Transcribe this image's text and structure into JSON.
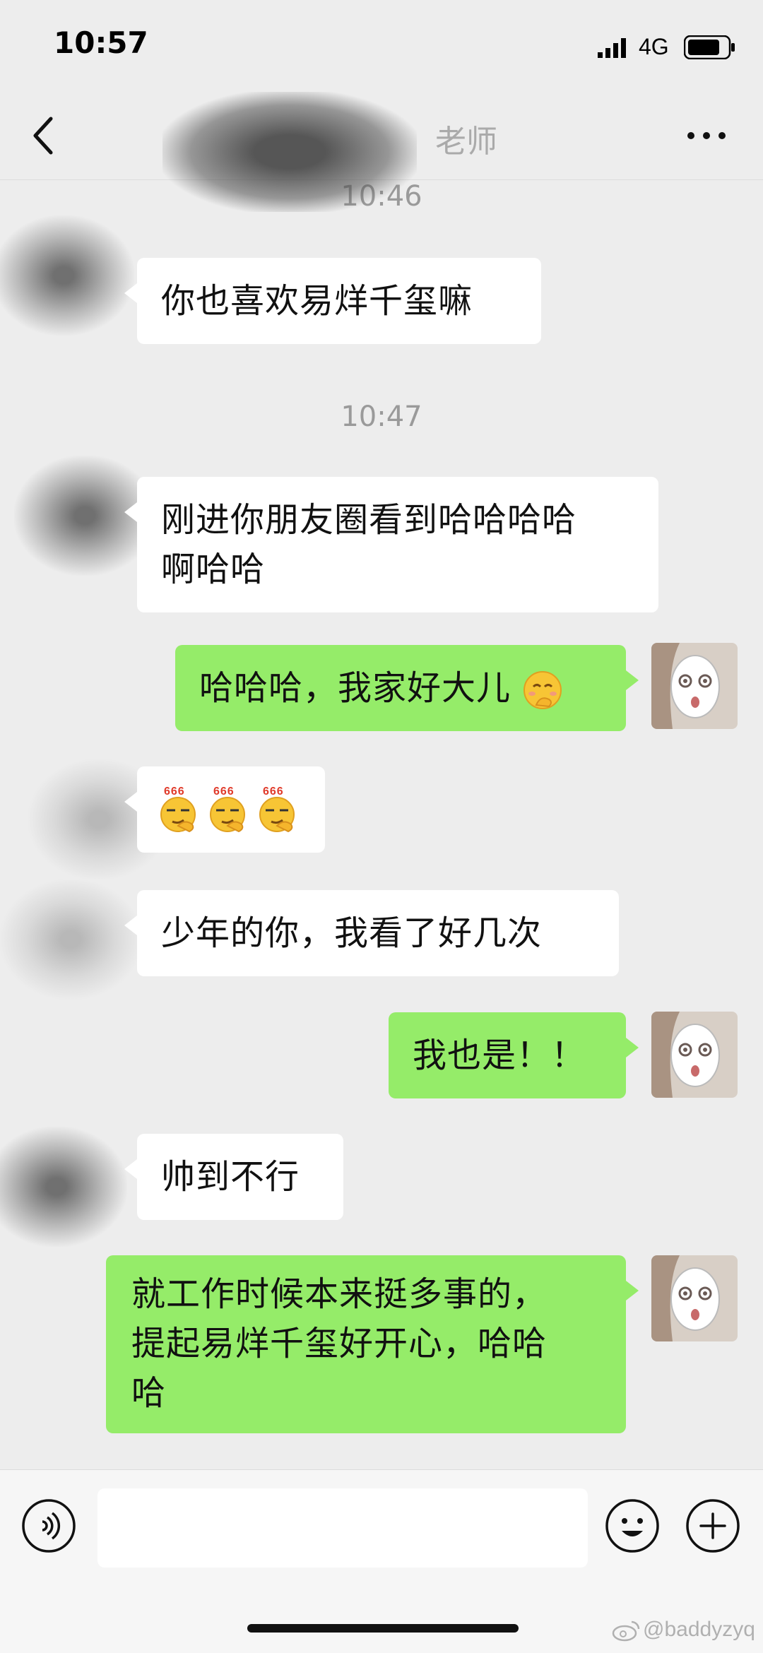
{
  "status_bar": {
    "time": "10:57",
    "network": "4G"
  },
  "nav": {
    "title": "老师"
  },
  "messages": [
    {
      "type": "timestamp",
      "text": "10:46"
    },
    {
      "type": "left",
      "text": "你也喜欢易烊千玺嘛"
    },
    {
      "type": "timestamp",
      "text": "10:47"
    },
    {
      "type": "left",
      "lines": [
        "刚进你朋友圈看到哈哈哈哈",
        "啊哈哈"
      ]
    },
    {
      "type": "right",
      "text": "哈哈哈，我家好大儿",
      "emoji": "blush-hand-over-mouth-emoji"
    },
    {
      "type": "left",
      "emoji": "666-smirk-emoji",
      "count": 3,
      "badge": "666"
    },
    {
      "type": "left",
      "text": "少年的你，我看了好几次"
    },
    {
      "type": "right",
      "text": "我也是！！"
    },
    {
      "type": "left",
      "text": "帅到不行"
    },
    {
      "type": "right",
      "lines": [
        "就工作时候本来挺多事的，",
        "提起易烊千玺好开心，哈哈",
        "哈"
      ]
    }
  ],
  "input_bar": {
    "placeholder": ""
  },
  "watermark": "@baddyzyq",
  "colors": {
    "background": "#ededed",
    "self_bubble": "#95ec69",
    "other_bubble": "#ffffff"
  }
}
